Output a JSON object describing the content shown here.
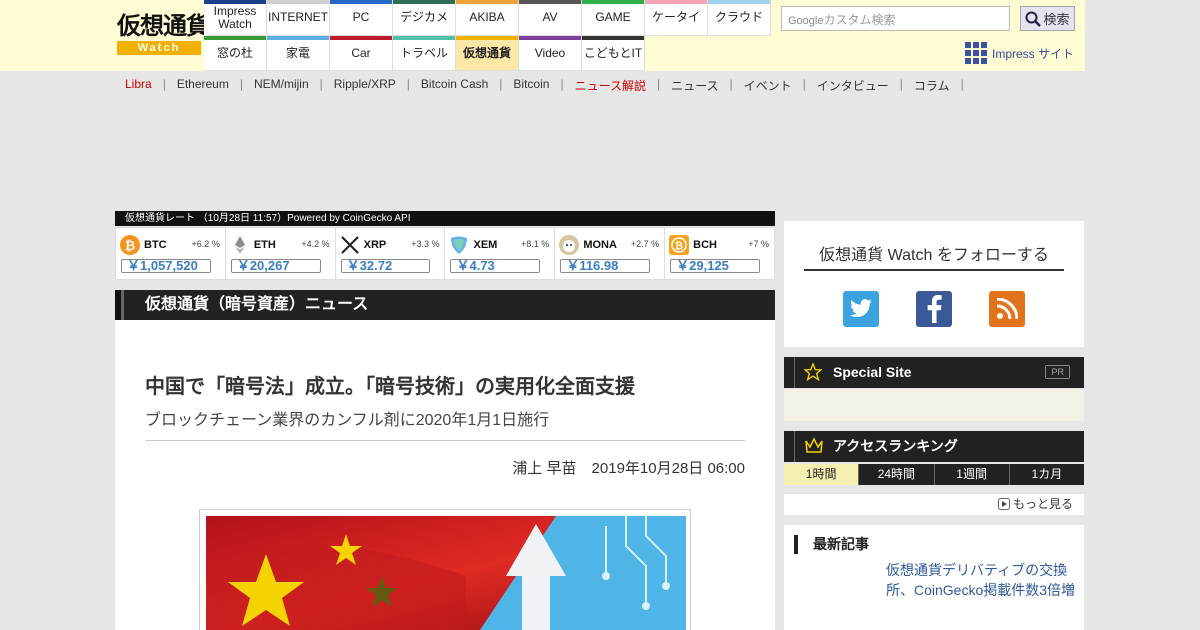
{
  "header": {
    "logo_line1": "仮想通貨",
    "logo_line2": "Watch",
    "nav": [
      {
        "label": "Impress Watch",
        "color": "#1e3f8a",
        "active": false
      },
      {
        "label": "INTERNET",
        "color": "#cfcfcf",
        "active": false
      },
      {
        "label": "PC",
        "color": "#2a67c9",
        "active": false
      },
      {
        "label": "デジカメ",
        "color": "#2d6d5a",
        "active": false
      },
      {
        "label": "AKIBA",
        "color": "#f2a23a",
        "active": false
      },
      {
        "label": "AV",
        "color": "#555555",
        "active": false
      },
      {
        "label": "GAME",
        "color": "#2fb04a",
        "active": false
      },
      {
        "label": "ケータイ",
        "color": "#f5a7b8",
        "active": false
      },
      {
        "label": "クラウド",
        "color": "#9fd3ea",
        "active": false
      },
      {
        "label": "窓の杜",
        "color": "#3a9a3a",
        "active": false
      },
      {
        "label": "家電",
        "color": "#5ab0e0",
        "active": false
      },
      {
        "label": "Car",
        "color": "#c0192b",
        "active": false
      },
      {
        "label": "トラベル",
        "color": "#4fc1a8",
        "active": false
      },
      {
        "label": "仮想通貨",
        "color": "#f2b100",
        "active": true
      },
      {
        "label": "Video",
        "color": "#7e3f9a",
        "active": false
      },
      {
        "label": "こどもとIT",
        "color": "#333333",
        "active": false
      }
    ],
    "search_placeholder": "カスタム検索",
    "search_google": "Google",
    "search_button": "検索",
    "impress_site": "Impress サイト"
  },
  "subnav": [
    {
      "label": "Libra",
      "red": true
    },
    {
      "label": "Ethereum",
      "red": false
    },
    {
      "label": "NEM/mijin",
      "red": false
    },
    {
      "label": "Ripple/XRP",
      "red": false
    },
    {
      "label": "Bitcoin Cash",
      "red": false
    },
    {
      "label": "Bitcoin",
      "red": false
    },
    {
      "label": "ニュース解説",
      "red": true
    },
    {
      "label": "ニュース",
      "red": false
    },
    {
      "label": "イベント",
      "red": false
    },
    {
      "label": "インタビュー",
      "red": false
    },
    {
      "label": "コラム",
      "red": false
    }
  ],
  "rates": {
    "header": "仮想通貨レート （10月28日 11:57）Powered by CoinGecko API",
    "coins": [
      {
        "symbol": "BTC",
        "change": "+6.2 %",
        "price": "￥1,057,520",
        "icon": "bitcoin-icon",
        "color": "#f7931a"
      },
      {
        "symbol": "ETH",
        "change": "+4.2 %",
        "price": "￥20,267",
        "icon": "ethereum-icon",
        "color": "#8c8c8c"
      },
      {
        "symbol": "XRP",
        "change": "+3.3 %",
        "price": "￥32.72",
        "icon": "xrp-icon",
        "color": "#222222"
      },
      {
        "symbol": "XEM",
        "change": "+8.1 %",
        "price": "￥4.73",
        "icon": "nem-icon",
        "color": "#67b2e8"
      },
      {
        "symbol": "MONA",
        "change": "+2.7 %",
        "price": "￥116.98",
        "icon": "monacoin-icon",
        "color": "#d7c4a0"
      },
      {
        "symbol": "BCH",
        "change": "+7 %",
        "price": "￥29,125",
        "icon": "bitcoin-cash-icon",
        "color": "#f7a21a"
      }
    ]
  },
  "section_title": "仮想通貨（暗号資産）ニュース",
  "article": {
    "title": "中国で「暗号法」成立。「暗号技術」の実用化全面支援",
    "subtitle": "ブロックチェーン業界のカンフル剤に2020年1月1日施行",
    "author": "浦上 早苗",
    "date": "2019年10月28日 06:00"
  },
  "sidebar": {
    "follow_title": "仮想通貨 Watch をフォローする",
    "social": [
      "twitter-icon",
      "facebook-icon",
      "rss-icon"
    ],
    "special_site": "Special Site",
    "pr": "PR",
    "ranking_title": "アクセスランキング",
    "ranking_tabs": [
      "1時間",
      "24時間",
      "1週間",
      "1カ月"
    ],
    "more": "もっと見る",
    "latest_title": "最新記事",
    "latest_item": "仮想通貨デリバティブの交換所、CoinGecko掲載件数3倍増"
  }
}
